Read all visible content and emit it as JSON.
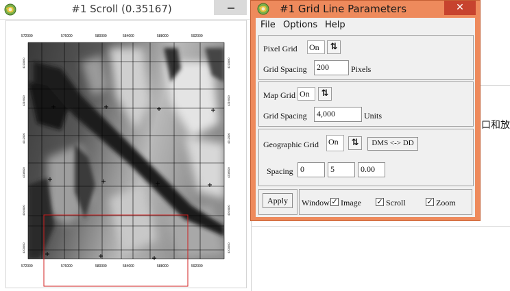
{
  "scroll_window": {
    "title": "#1 Scroll (0.35167)",
    "top_labels": [
      "572000",
      "576000",
      "580000",
      "584000",
      "588000",
      "592000"
    ],
    "bottom_labels": [
      "572000",
      "576000",
      "580000",
      "584000",
      "588000",
      "592000"
    ]
  },
  "background_window": {
    "text": "口和放大"
  },
  "dialog": {
    "title": "#1 Grid Line Parameters",
    "close_glyph": "✕",
    "menu": {
      "file": "File",
      "options": "Options",
      "help": "Help"
    },
    "pixel_grid": {
      "label": "Pixel Grid",
      "toggle": "On",
      "spacing_label": "Grid Spacing",
      "spacing_value": "200",
      "unit": "Pixels"
    },
    "map_grid": {
      "label": "Map Grid",
      "toggle": "On",
      "spacing_label": "Grid Spacing",
      "spacing_value": "4,000",
      "unit": "Units"
    },
    "geographic_grid": {
      "label": "Geographic Grid",
      "toggle": "On",
      "dms_button": "DMS <-> DD",
      "spacing_label": "Spacing",
      "deg": "0",
      "min": "5",
      "sec": "0.00"
    },
    "apply_label": "Apply",
    "window_label": "Window",
    "image_label": "Image",
    "scroll_label": "Scroll",
    "zoom_label": "Zoom",
    "arrow_glyph": "⇅",
    "check_glyph": "✓",
    "colors": {
      "title_bar": "#ee8a5c",
      "close": "#c7432e"
    }
  }
}
